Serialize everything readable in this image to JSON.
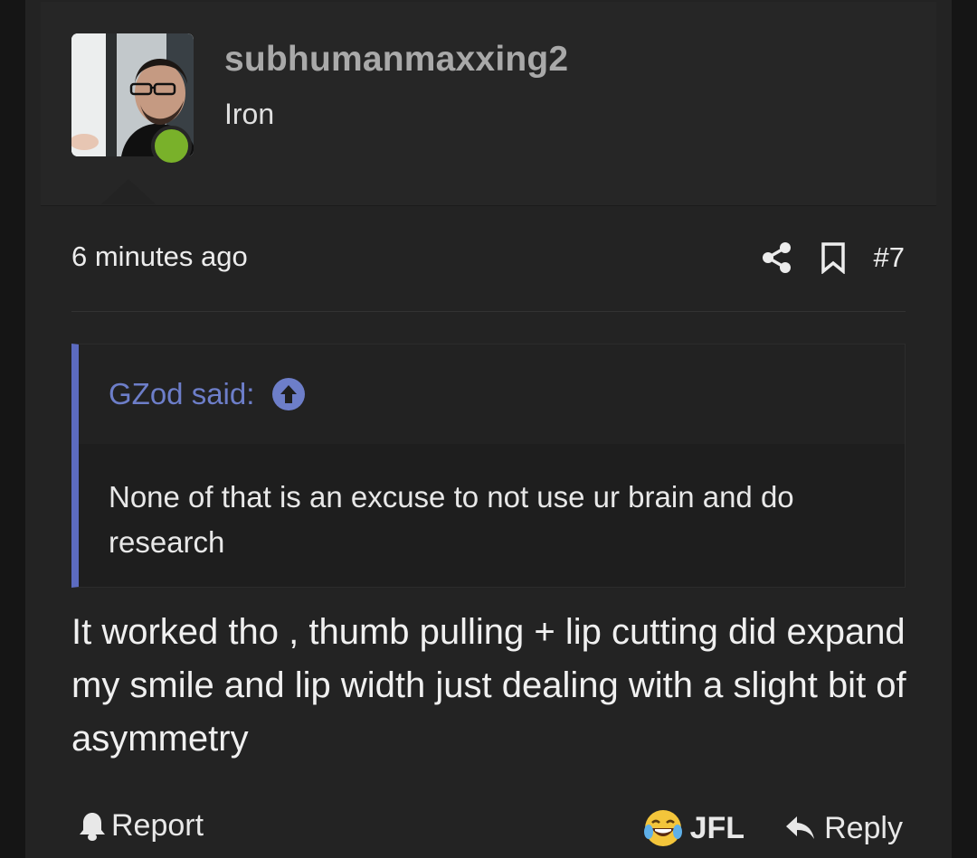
{
  "user": {
    "name": "subhumanmaxxing2",
    "title": "Iron",
    "avatar_icon": "user-avatar-photo",
    "online": true
  },
  "post": {
    "time": "6 minutes ago",
    "number": "#7",
    "share_icon": "share-icon",
    "bookmark_icon": "bookmark-icon"
  },
  "quote": {
    "author": "GZod said:",
    "jump_icon": "arrow-up-circle-icon",
    "text": "None of that is an excuse to not use ur brain and do research"
  },
  "message": "It worked tho , thumb pulling + lip cutting did expand my smile and lip width just dealing with a slight bit of asymmetry",
  "footer": {
    "report_label": "Report",
    "react_label": "JFL",
    "reply_label": "Reply"
  },
  "colors": {
    "accent": "#5c6bc0",
    "online": "#79b12a",
    "background": "#232323"
  }
}
